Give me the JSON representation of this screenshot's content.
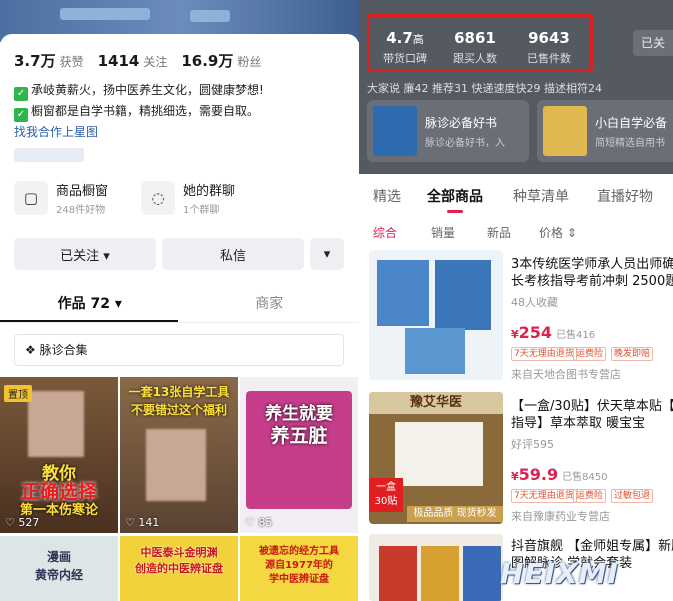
{
  "left": {
    "stats": [
      {
        "value": "3.7万",
        "label": "获赞"
      },
      {
        "value": "1414",
        "label": "关注"
      },
      {
        "value": "16.9万",
        "label": "粉丝"
      }
    ],
    "bio": [
      "承岐黄薪火，扬中医养生文化，圆健康梦想!",
      "橱窗都是自学书籍，精挑细选，需要自取。"
    ],
    "bio_link": "找我合作上星图",
    "services": [
      {
        "title": "商品橱窗",
        "sub": "248件好物",
        "icon": "shop-window-icon"
      },
      {
        "title": "她的群聊",
        "sub": "1个群聊",
        "icon": "chat-bubble-icon"
      }
    ],
    "followed_btn": "已关注 ▾",
    "message_btn": "私信",
    "more_btn": "▾",
    "tabs": [
      "作品 72 ▾",
      "商家"
    ],
    "collection": "脉诊合集",
    "videos": [
      {
        "pinned": "置顶",
        "caption1": "教你",
        "caption2": "正确选择",
        "caption3": "第一本伤寒论",
        "likes": "527"
      },
      {
        "caption1": "一套13张自学工具",
        "caption2": "不要错过这个福利",
        "likes": "141"
      },
      {
        "caption1": "养生就要",
        "caption2": "养五脏",
        "likes": "85"
      },
      {
        "caption1": "漫画",
        "caption2": "黄帝内经"
      },
      {
        "caption1": "中医泰斗金明渊",
        "caption2": "创造的中医辨证盘"
      },
      {
        "caption1": "被遗忘的经方工具",
        "caption2": "源自1977年的",
        "caption3": "学中医辨证盘"
      }
    ]
  },
  "right": {
    "stats": [
      {
        "value": "4.7",
        "unit": "高",
        "label": "带货口碑"
      },
      {
        "value": "6861",
        "label": "跟买人数"
      },
      {
        "value": "9643",
        "label": "已售件数"
      }
    ],
    "follow_btn": "已关",
    "score_line": "大家说  廉42    推荐31    快递速度快29    描述相符24",
    "promos": [
      {
        "title": "脉诊必备好书",
        "sub": "脉诊必备好书，入"
      },
      {
        "title": "小白自学必备",
        "sub": "简短精选自用书"
      }
    ],
    "tabs": [
      "精选",
      "全部商品",
      "种草清单",
      "直播好物"
    ],
    "sorts": [
      "综合",
      "销量",
      "新品",
      "价格 ⇕"
    ],
    "products": [
      {
        "title1": "3本传统医学师承人员出师确",
        "title2": "长考核指导考前冲刺 2500题",
        "sub": "48人收藏",
        "price": "254",
        "sold": "已售416",
        "tags": [
          "7天无理由退货",
          "运费险",
          "晚发即赔"
        ],
        "shop": "来自天地合图书专营店"
      },
      {
        "title1": "【一盒/30贴】伏天草本贴【一",
        "title2": "指导】草本萃取  暖宝宝",
        "sub": "好评595",
        "price": "59.9",
        "sold": "已售8450",
        "tags": [
          "7天无理由退货",
          "运费险",
          "过敏包退"
        ],
        "shop": "来自豫康药业专营店",
        "img_label": "豫艾华医",
        "img_badge": "一盒 30贴",
        "img_foot": "极品品质 现货秒发"
      },
      {
        "title1": "抖音旗舰 【金师姐专属】新版",
        "title2": "图解脉诊 学就会套装"
      }
    ],
    "watermark": "HEIXMI"
  }
}
